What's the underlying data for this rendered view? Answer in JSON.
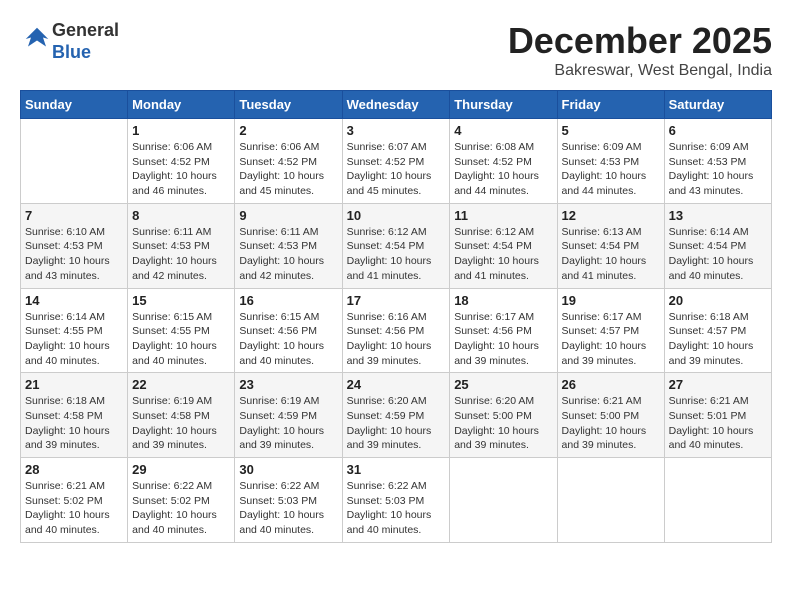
{
  "logo": {
    "general": "General",
    "blue": "Blue"
  },
  "title": "December 2025",
  "location": "Bakreswar, West Bengal, India",
  "days_of_week": [
    "Sunday",
    "Monday",
    "Tuesday",
    "Wednesday",
    "Thursday",
    "Friday",
    "Saturday"
  ],
  "weeks": [
    [
      {
        "day": "",
        "info": ""
      },
      {
        "day": "1",
        "info": "Sunrise: 6:06 AM\nSunset: 4:52 PM\nDaylight: 10 hours and 46 minutes."
      },
      {
        "day": "2",
        "info": "Sunrise: 6:06 AM\nSunset: 4:52 PM\nDaylight: 10 hours and 45 minutes."
      },
      {
        "day": "3",
        "info": "Sunrise: 6:07 AM\nSunset: 4:52 PM\nDaylight: 10 hours and 45 minutes."
      },
      {
        "day": "4",
        "info": "Sunrise: 6:08 AM\nSunset: 4:52 PM\nDaylight: 10 hours and 44 minutes."
      },
      {
        "day": "5",
        "info": "Sunrise: 6:09 AM\nSunset: 4:53 PM\nDaylight: 10 hours and 44 minutes."
      },
      {
        "day": "6",
        "info": "Sunrise: 6:09 AM\nSunset: 4:53 PM\nDaylight: 10 hours and 43 minutes."
      }
    ],
    [
      {
        "day": "7",
        "info": "Sunrise: 6:10 AM\nSunset: 4:53 PM\nDaylight: 10 hours and 43 minutes."
      },
      {
        "day": "8",
        "info": "Sunrise: 6:11 AM\nSunset: 4:53 PM\nDaylight: 10 hours and 42 minutes."
      },
      {
        "day": "9",
        "info": "Sunrise: 6:11 AM\nSunset: 4:53 PM\nDaylight: 10 hours and 42 minutes."
      },
      {
        "day": "10",
        "info": "Sunrise: 6:12 AM\nSunset: 4:54 PM\nDaylight: 10 hours and 41 minutes."
      },
      {
        "day": "11",
        "info": "Sunrise: 6:12 AM\nSunset: 4:54 PM\nDaylight: 10 hours and 41 minutes."
      },
      {
        "day": "12",
        "info": "Sunrise: 6:13 AM\nSunset: 4:54 PM\nDaylight: 10 hours and 41 minutes."
      },
      {
        "day": "13",
        "info": "Sunrise: 6:14 AM\nSunset: 4:54 PM\nDaylight: 10 hours and 40 minutes."
      }
    ],
    [
      {
        "day": "14",
        "info": "Sunrise: 6:14 AM\nSunset: 4:55 PM\nDaylight: 10 hours and 40 minutes."
      },
      {
        "day": "15",
        "info": "Sunrise: 6:15 AM\nSunset: 4:55 PM\nDaylight: 10 hours and 40 minutes."
      },
      {
        "day": "16",
        "info": "Sunrise: 6:15 AM\nSunset: 4:56 PM\nDaylight: 10 hours and 40 minutes."
      },
      {
        "day": "17",
        "info": "Sunrise: 6:16 AM\nSunset: 4:56 PM\nDaylight: 10 hours and 39 minutes."
      },
      {
        "day": "18",
        "info": "Sunrise: 6:17 AM\nSunset: 4:56 PM\nDaylight: 10 hours and 39 minutes."
      },
      {
        "day": "19",
        "info": "Sunrise: 6:17 AM\nSunset: 4:57 PM\nDaylight: 10 hours and 39 minutes."
      },
      {
        "day": "20",
        "info": "Sunrise: 6:18 AM\nSunset: 4:57 PM\nDaylight: 10 hours and 39 minutes."
      }
    ],
    [
      {
        "day": "21",
        "info": "Sunrise: 6:18 AM\nSunset: 4:58 PM\nDaylight: 10 hours and 39 minutes."
      },
      {
        "day": "22",
        "info": "Sunrise: 6:19 AM\nSunset: 4:58 PM\nDaylight: 10 hours and 39 minutes."
      },
      {
        "day": "23",
        "info": "Sunrise: 6:19 AM\nSunset: 4:59 PM\nDaylight: 10 hours and 39 minutes."
      },
      {
        "day": "24",
        "info": "Sunrise: 6:20 AM\nSunset: 4:59 PM\nDaylight: 10 hours and 39 minutes."
      },
      {
        "day": "25",
        "info": "Sunrise: 6:20 AM\nSunset: 5:00 PM\nDaylight: 10 hours and 39 minutes."
      },
      {
        "day": "26",
        "info": "Sunrise: 6:21 AM\nSunset: 5:00 PM\nDaylight: 10 hours and 39 minutes."
      },
      {
        "day": "27",
        "info": "Sunrise: 6:21 AM\nSunset: 5:01 PM\nDaylight: 10 hours and 40 minutes."
      }
    ],
    [
      {
        "day": "28",
        "info": "Sunrise: 6:21 AM\nSunset: 5:02 PM\nDaylight: 10 hours and 40 minutes."
      },
      {
        "day": "29",
        "info": "Sunrise: 6:22 AM\nSunset: 5:02 PM\nDaylight: 10 hours and 40 minutes."
      },
      {
        "day": "30",
        "info": "Sunrise: 6:22 AM\nSunset: 5:03 PM\nDaylight: 10 hours and 40 minutes."
      },
      {
        "day": "31",
        "info": "Sunrise: 6:22 AM\nSunset: 5:03 PM\nDaylight: 10 hours and 40 minutes."
      },
      {
        "day": "",
        "info": ""
      },
      {
        "day": "",
        "info": ""
      },
      {
        "day": "",
        "info": ""
      }
    ]
  ]
}
